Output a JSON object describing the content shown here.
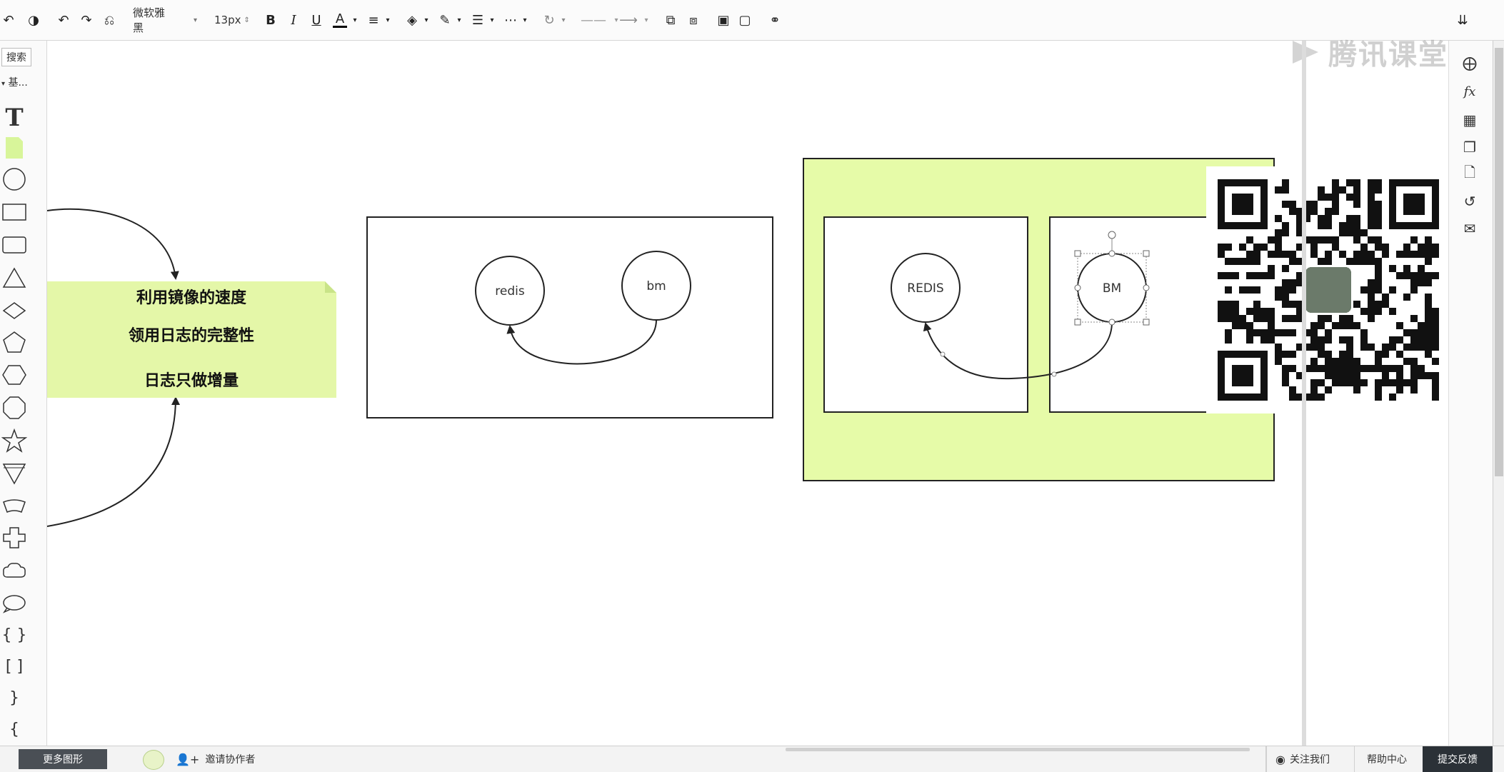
{
  "toolbar": {
    "font_family": "微软雅黑",
    "font_size": "13px",
    "bold_label": "B",
    "italic_label": "I",
    "underline_label": "U",
    "font_color_label": "A"
  },
  "left_panel": {
    "search_label": "搜索",
    "category_label": "基..."
  },
  "canvas": {
    "note_lines": [
      "利用镜像的速度",
      "领用日志的完整性",
      "日志只做增量"
    ],
    "diagram1": {
      "node_a": "redis",
      "node_b": "bm"
    },
    "diagram2": {
      "node_a": "REDIS",
      "node_b": "BM"
    }
  },
  "watermark": "腾讯课堂",
  "bottom": {
    "more_shapes": "更多图形",
    "invite": "邀请协作者",
    "follow": "关注我们",
    "help": "帮助中心",
    "feedback": "提交反馈"
  },
  "colors": {
    "note_fill": "#e4f7a8",
    "container_fill": "#e6fba8",
    "dark_button": "#2b3137"
  }
}
